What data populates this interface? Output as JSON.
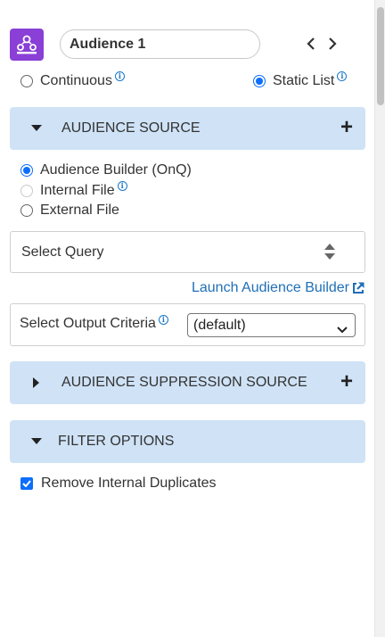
{
  "header": {
    "app_icon": "people-network-icon",
    "title_value": "Audience 1",
    "prev_icon": "chevron-left-icon",
    "next_icon": "chevron-right-icon"
  },
  "list_type": {
    "options": [
      {
        "label": "Continuous",
        "selected": false,
        "info": true
      },
      {
        "label": "Static List",
        "selected": true,
        "info": true
      }
    ]
  },
  "audience_source": {
    "title": "AUDIENCE SOURCE",
    "expanded": true,
    "options": [
      {
        "label": "Audience Builder (OnQ)",
        "selected": true,
        "disabled": false
      },
      {
        "label": "Internal File",
        "selected": false,
        "disabled": true,
        "info": true
      },
      {
        "label": "External File",
        "selected": false,
        "disabled": false
      }
    ],
    "query_placeholder": "Select Query",
    "launch_label": "Launch Audience Builder",
    "launch_icon": "external-link-icon",
    "criteria_label": "Select Output Criteria",
    "criteria_value": "(default)"
  },
  "suppression_source": {
    "title": "AUDIENCE SUPPRESSION SOURCE",
    "expanded": false
  },
  "filter_options": {
    "title": "FILTER OPTIONS",
    "expanded": true,
    "remove_duplicates_label": "Remove Internal Duplicates",
    "remove_duplicates_checked": true
  },
  "colors": {
    "accent": "#0d6efd",
    "section_bg": "#cfe2f6",
    "app_icon_bg": "#8a3fd6",
    "link": "#1f6fb8"
  }
}
